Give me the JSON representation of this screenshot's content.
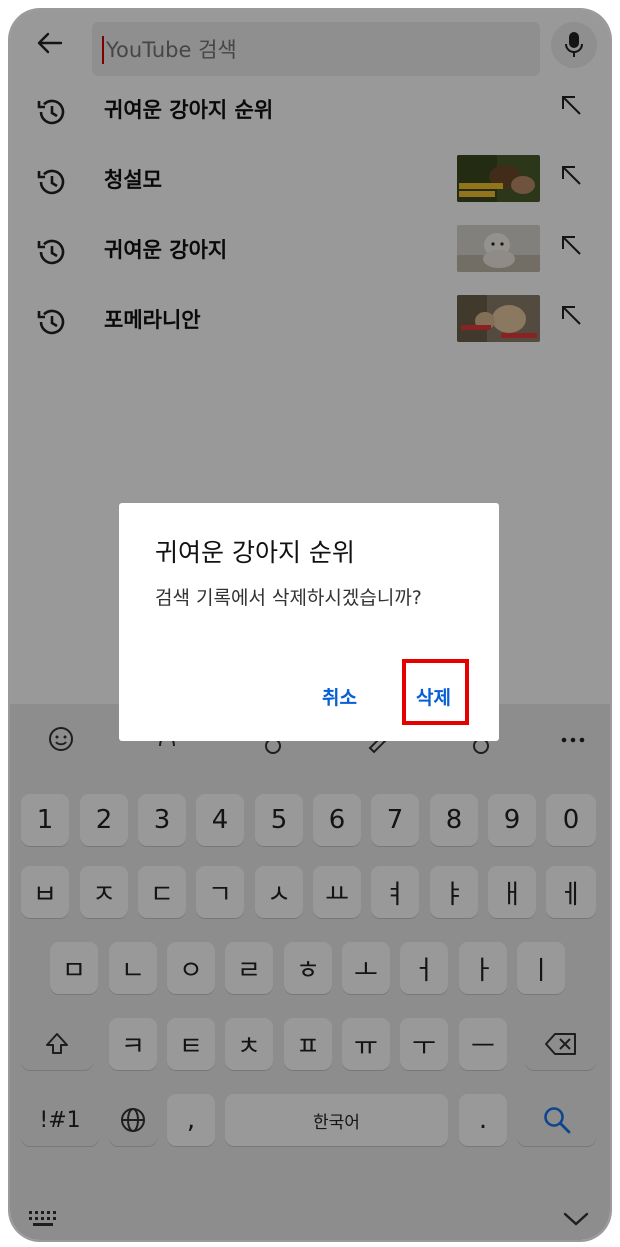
{
  "search": {
    "placeholder": "YouTube 검색",
    "back_icon": "arrow-left-icon",
    "mic_icon": "microphone-icon"
  },
  "history": [
    {
      "label": "귀여운 강아지 순위",
      "has_thumbnail": false
    },
    {
      "label": "청설모",
      "has_thumbnail": true
    },
    {
      "label": "귀여운 강아지",
      "has_thumbnail": true
    },
    {
      "label": "포메라니안",
      "has_thumbnail": true
    }
  ],
  "dialog": {
    "title": "귀여운 강아지 순위",
    "message": "검색 기록에서 삭제하시겠습니까?",
    "cancel_label": "취소",
    "delete_label": "삭제",
    "accent_color": "#065fd4",
    "highlight_color": "#e60000"
  },
  "keyboard": {
    "toolbar": [
      "emoji-icon",
      "sticker-icon",
      "settings-icon",
      "handwriting-icon",
      "search-icon",
      "more-icon"
    ],
    "numbers": [
      "1",
      "2",
      "3",
      "4",
      "5",
      "6",
      "7",
      "8",
      "9",
      "0"
    ],
    "row1": [
      "ㅂ",
      "ㅈ",
      "ㄷ",
      "ㄱ",
      "ㅅ",
      "ㅛ",
      "ㅕ",
      "ㅑ",
      "ㅐ",
      "ㅔ"
    ],
    "row2": [
      "ㅁ",
      "ㄴ",
      "ㅇ",
      "ㄹ",
      "ㅎ",
      "ㅗ",
      "ㅓ",
      "ㅏ",
      "ㅣ"
    ],
    "row3": [
      "ㅋ",
      "ㅌ",
      "ㅊ",
      "ㅍ",
      "ㅠ",
      "ㅜ",
      "ㅡ"
    ],
    "symbols_label": "!#1",
    "comma": ",",
    "space_label": "한국어",
    "period": "."
  }
}
